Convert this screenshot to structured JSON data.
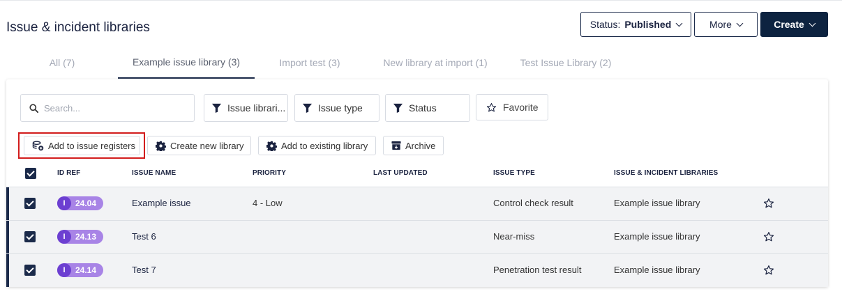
{
  "page": {
    "title": "Issue & incident libraries"
  },
  "header": {
    "status_prefix": "Status:",
    "status_value": "Published",
    "more_label": "More",
    "create_label": "Create"
  },
  "tabs": [
    {
      "label": "All (7)",
      "active": false
    },
    {
      "label": "Example issue library (3)",
      "active": true
    },
    {
      "label": "Import test (3)",
      "active": false
    },
    {
      "label": "New library at import (1)",
      "active": false
    },
    {
      "label": "Test Issue Library (2)",
      "active": false
    }
  ],
  "filters": {
    "search_placeholder": "Search...",
    "issue_libraries": "Issue librari...",
    "issue_type": "Issue type",
    "status": "Status",
    "favorite": "Favorite"
  },
  "actions": {
    "add_to_registers": "Add to issue registers",
    "create_library": "Create new library",
    "add_existing": "Add to existing library",
    "archive": "Archive"
  },
  "columns": [
    "ID REF",
    "ISSUE NAME",
    "PRIORITY",
    "LAST UPDATED",
    "ISSUE TYPE",
    "ISSUE & INCIDENT LIBRARIES"
  ],
  "rows": [
    {
      "id_letter": "I",
      "id_ref": "24.04",
      "name": "Example issue",
      "priority": "4 - Low",
      "last_updated": "",
      "issue_type": "Control check result",
      "library": "Example issue library"
    },
    {
      "id_letter": "I",
      "id_ref": "24.13",
      "name": "Test 6",
      "priority": "",
      "last_updated": "",
      "issue_type": "Near-miss",
      "library": "Example issue library"
    },
    {
      "id_letter": "I",
      "id_ref": "24.14",
      "name": "Test 7",
      "priority": "",
      "last_updated": "",
      "issue_type": "Penetration test result",
      "library": "Example issue library"
    }
  ],
  "colors": {
    "accent": "#1b2a4a",
    "badge": "#a884e6",
    "badge_letter": "#6c3fd1",
    "highlight": "#d21c1c"
  }
}
